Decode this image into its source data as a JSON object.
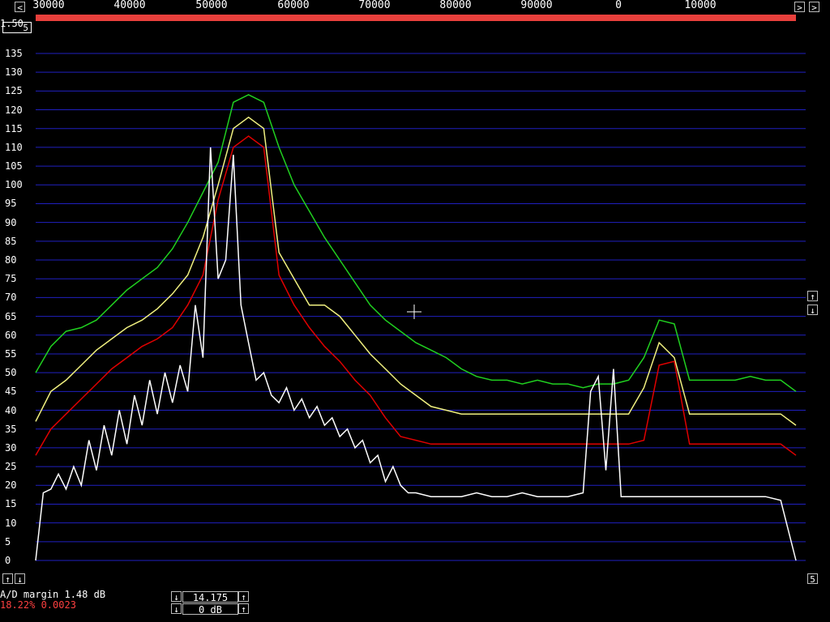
{
  "top_scale": {
    "ticks": [
      "30000",
      "40000",
      "50000",
      "60000",
      "70000",
      "80000",
      "90000",
      "0",
      "10000"
    ],
    "left_arrow": "<",
    "right_arrow": ">"
  },
  "top_left_value": "1.50",
  "top_left_box": "5",
  "y_axis": {
    "ticks": [
      "135",
      "130",
      "125",
      "120",
      "115",
      "110",
      "105",
      "100",
      "95",
      "90",
      "85",
      "80",
      "75",
      "70",
      "65",
      "60",
      "55",
      "50",
      "45",
      "40",
      "35",
      "30",
      "25",
      "20",
      "15",
      "10",
      "5",
      "0"
    ]
  },
  "right_buttons": {
    "up": "↑",
    "down": "↓",
    "bottom_box": "5"
  },
  "bottom_left_buttons": {
    "up": "↑",
    "down": "↓"
  },
  "status": {
    "ad_margin": "A/D margin  1.48 dB",
    "ratio": "18.22% 0.0023"
  },
  "freq_control": {
    "frequency": "14.175",
    "gain": "0 dB",
    "up": "↑",
    "down": "↓"
  },
  "colors": {
    "background": "#000000",
    "grid": "#2020c0",
    "trace_green": "#20d020",
    "trace_yellow": "#f0f080",
    "trace_red": "#e00000",
    "trace_white": "#ffffff",
    "bar_red": "#e8403c"
  },
  "chart_data": {
    "type": "line",
    "ylim": [
      0,
      137
    ],
    "series": [
      {
        "color": "#20d020",
        "x": [
          0,
          2,
          4,
          6,
          8,
          10,
          12,
          14,
          16,
          18,
          20,
          22,
          24,
          26,
          28,
          30,
          32,
          34,
          36,
          38,
          40,
          42,
          44,
          46,
          48,
          50,
          52,
          54,
          56,
          58,
          60,
          62,
          64,
          66,
          68,
          70,
          72,
          74,
          76,
          78,
          80,
          82,
          84,
          86,
          88,
          90,
          92,
          94,
          96,
          98,
          100
        ],
        "y": [
          50,
          57,
          61,
          62,
          64,
          68,
          72,
          75,
          78,
          83,
          90,
          98,
          106,
          122,
          124,
          122,
          110,
          100,
          93,
          86,
          80,
          74,
          68,
          64,
          61,
          58,
          56,
          54,
          51,
          49,
          48,
          48,
          47,
          48,
          47,
          47,
          46,
          47,
          47,
          48,
          54,
          64,
          63,
          48,
          48,
          48,
          48,
          49,
          48,
          48,
          45
        ]
      },
      {
        "color": "#f0f080",
        "x": [
          0,
          2,
          4,
          6,
          8,
          10,
          12,
          14,
          16,
          18,
          20,
          22,
          24,
          26,
          28,
          30,
          32,
          34,
          36,
          38,
          40,
          42,
          44,
          46,
          48,
          50,
          52,
          54,
          56,
          58,
          60,
          62,
          64,
          66,
          68,
          70,
          72,
          74,
          76,
          78,
          80,
          82,
          84,
          86,
          88,
          90,
          92,
          94,
          96,
          98,
          100
        ],
        "y": [
          37,
          45,
          48,
          52,
          56,
          59,
          62,
          64,
          67,
          71,
          76,
          86,
          100,
          115,
          118,
          115,
          82,
          75,
          68,
          68,
          65,
          60,
          55,
          51,
          47,
          44,
          41,
          40,
          39,
          39,
          39,
          39,
          39,
          39,
          39,
          39,
          39,
          39,
          39,
          39,
          46,
          58,
          54,
          39,
          39,
          39,
          39,
          39,
          39,
          39,
          36
        ]
      },
      {
        "color": "#e00000",
        "x": [
          0,
          2,
          4,
          6,
          8,
          10,
          12,
          14,
          16,
          18,
          20,
          22,
          24,
          26,
          28,
          30,
          32,
          34,
          36,
          38,
          40,
          42,
          44,
          46,
          48,
          50,
          52,
          54,
          56,
          58,
          60,
          62,
          64,
          66,
          68,
          70,
          72,
          74,
          76,
          78,
          80,
          82,
          84,
          86,
          88,
          90,
          92,
          94,
          96,
          98,
          100
        ],
        "y": [
          28,
          35,
          39,
          43,
          47,
          51,
          54,
          57,
          59,
          62,
          68,
          76,
          96,
          110,
          113,
          110,
          76,
          68,
          62,
          57,
          53,
          48,
          44,
          38,
          33,
          32,
          31,
          31,
          31,
          31,
          31,
          31,
          31,
          31,
          31,
          31,
          31,
          31,
          31,
          31,
          32,
          52,
          53,
          31,
          31,
          31,
          31,
          31,
          31,
          31,
          28
        ]
      },
      {
        "color": "#ffffff",
        "x": [
          0,
          1,
          2,
          3,
          4,
          5,
          6,
          7,
          8,
          9,
          10,
          11,
          12,
          13,
          14,
          15,
          16,
          17,
          18,
          19,
          20,
          21,
          22,
          23,
          24,
          25,
          26,
          27,
          28,
          29,
          30,
          31,
          32,
          33,
          34,
          35,
          36,
          37,
          38,
          39,
          40,
          41,
          42,
          43,
          44,
          45,
          46,
          47,
          48,
          49,
          50,
          52,
          54,
          56,
          58,
          60,
          62,
          64,
          66,
          68,
          70,
          72,
          73,
          74,
          75,
          76,
          77,
          78,
          79,
          80,
          82,
          84,
          86,
          88,
          90,
          92,
          94,
          96,
          98,
          100
        ],
        "y": [
          0,
          18,
          19,
          23,
          19,
          25,
          20,
          32,
          24,
          36,
          28,
          40,
          31,
          44,
          36,
          48,
          39,
          50,
          42,
          52,
          45,
          68,
          54,
          110,
          75,
          80,
          108,
          68,
          58,
          48,
          50,
          44,
          42,
          46,
          40,
          43,
          38,
          41,
          36,
          38,
          33,
          35,
          30,
          32,
          26,
          28,
          21,
          25,
          20,
          18,
          18,
          17,
          17,
          17,
          18,
          17,
          17,
          18,
          17,
          17,
          17,
          18,
          45,
          49,
          24,
          51,
          17,
          17,
          17,
          17,
          17,
          17,
          17,
          17,
          17,
          17,
          17,
          17,
          16,
          0
        ]
      }
    ]
  }
}
